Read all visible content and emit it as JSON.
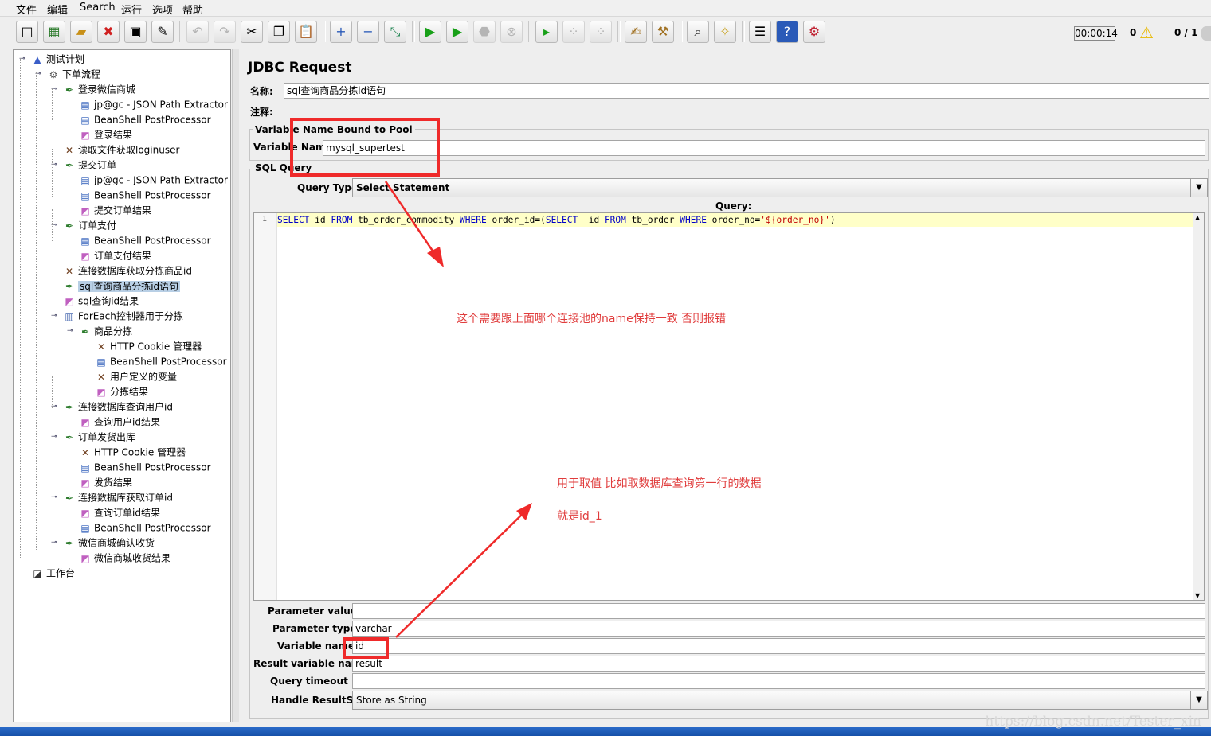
{
  "menu": [
    "文件",
    "编辑",
    "Search",
    "运行",
    "选项",
    "帮助"
  ],
  "toolbar": {
    "timer": "00:00:14",
    "warnings": "0",
    "threads": "0 / 1"
  },
  "tree": {
    "nodes": [
      {
        "label": "测试计划",
        "icon": "test-plan-icon"
      },
      {
        "label": "下单流程",
        "icon": "gear-icon"
      },
      {
        "label": "登录微信商城",
        "icon": "pipette-icon"
      },
      {
        "label": "jp@gc - JSON Path Extractor",
        "icon": "postprocessor-icon"
      },
      {
        "label": "BeanShell PostProcessor",
        "icon": "postprocessor-icon"
      },
      {
        "label": "登录结果",
        "icon": "listener-icon"
      },
      {
        "label": "读取文件获取loginuser",
        "icon": "config-tools-icon"
      },
      {
        "label": "提交订单",
        "icon": "pipette-icon"
      },
      {
        "label": "jp@gc - JSON Path Extractor",
        "icon": "postprocessor-icon"
      },
      {
        "label": "BeanShell PostProcessor",
        "icon": "postprocessor-icon"
      },
      {
        "label": "提交订单结果",
        "icon": "listener-icon"
      },
      {
        "label": "订单支付",
        "icon": "pipette-icon"
      },
      {
        "label": "BeanShell PostProcessor",
        "icon": "postprocessor-icon"
      },
      {
        "label": "订单支付结果",
        "icon": "listener-icon"
      },
      {
        "label": "连接数据库获取分拣商品id",
        "icon": "config-tools-icon"
      },
      {
        "label": "sql查询商品分拣id语句",
        "icon": "pipette-icon"
      },
      {
        "label": "sql查询id结果",
        "icon": "listener-icon"
      },
      {
        "label": "ForEach控制器用于分拣",
        "icon": "foreach-icon"
      },
      {
        "label": "商品分拣",
        "icon": "pipette-icon"
      },
      {
        "label": "HTTP Cookie 管理器",
        "icon": "config-tools-icon"
      },
      {
        "label": "BeanShell PostProcessor",
        "icon": "postprocessor-icon"
      },
      {
        "label": "用户定义的变量",
        "icon": "config-tools-icon"
      },
      {
        "label": "分拣结果",
        "icon": "listener-icon"
      },
      {
        "label": "连接数据库查询用户id",
        "icon": "pipette-icon"
      },
      {
        "label": "查询用户id结果",
        "icon": "listener-icon"
      },
      {
        "label": "订单发货出库",
        "icon": "pipette-icon"
      },
      {
        "label": "HTTP Cookie 管理器",
        "icon": "config-tools-icon"
      },
      {
        "label": "BeanShell PostProcessor",
        "icon": "postprocessor-icon"
      },
      {
        "label": "发货结果",
        "icon": "listener-icon"
      },
      {
        "label": "连接数据库获取订单id",
        "icon": "pipette-icon"
      },
      {
        "label": "查询订单id结果",
        "icon": "listener-icon"
      },
      {
        "label": "BeanShell PostProcessor",
        "icon": "postprocessor-icon"
      },
      {
        "label": "微信商城确认收货",
        "icon": "pipette-icon"
      },
      {
        "label": "微信商城收货结果",
        "icon": "listener-icon"
      },
      {
        "label": "工作台",
        "icon": "workbench-icon"
      }
    ]
  },
  "panel": {
    "title": "JDBC Request",
    "name_label": "名称:",
    "name_value": "sql查询商品分拣id语句",
    "comment_label": "注释:",
    "pool_group": "Variable Name Bound to Pool",
    "pool_label": "Variable Name:",
    "pool_value": "mysql_supertest",
    "sql_group": "SQL Query",
    "query_type_label": "Query Type:",
    "query_type_value": "Select Statement",
    "query_label": "Query:",
    "line_number": "1",
    "params_label": "Parameter values:",
    "params_value": "",
    "param_types_label": "Parameter types:",
    "param_types_value": "varchar",
    "var_names_label": "Variable names:",
    "var_names_value": "id",
    "result_var_label": "Result variable name:",
    "result_var_value": "result",
    "timeout_label": "Query timeout (s):",
    "timeout_value": "",
    "handle_label": "Handle ResultSet:",
    "handle_value": "Store as String"
  },
  "annotations": {
    "note1": "这个需要跟上面哪个连接池的name保持一致   否则报错",
    "note2": "用于取值   比如取数据库查询第一行的数据",
    "note3": "就是id_1"
  },
  "watermark": "https://blog.csdn.net/Tester_xin",
  "colors": {
    "annotation_red": "#ef2a2a",
    "selection": "#b8cfe5",
    "code_highlight": "#ffffc8",
    "sql_keyword": "#0000c8"
  }
}
